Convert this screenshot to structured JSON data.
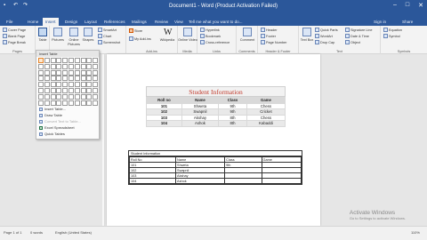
{
  "window": {
    "title": "Document1 - Word (Product Activation Failed)",
    "minimize": "–",
    "maximize": "□",
    "close": "✕"
  },
  "tabs": [
    "File",
    "Home",
    "Insert",
    "Design",
    "Layout",
    "References",
    "Mailings",
    "Review",
    "View"
  ],
  "active_tab": "Insert",
  "tell_me": "Tell me what you want to do...",
  "account": "Sign in",
  "share": "Share",
  "ribbon": {
    "pages": {
      "label": "Pages",
      "items": [
        "Cover Page",
        "Blank Page",
        "Page Break"
      ]
    },
    "tables": {
      "label": "Tables",
      "table_button": "Table"
    },
    "illustrations": {
      "label": "Illustrations",
      "pictures": "Pictures",
      "online_pictures": "Online Pictures",
      "shapes": "Shapes",
      "smartart": "SmartArt",
      "chart": "Chart",
      "screenshot": "Screenshot"
    },
    "addins": {
      "label": "Add-ins",
      "store": "Store",
      "my_addins": "My Add-ins",
      "wikipedia": "Wikipedia"
    },
    "media": {
      "label": "Media",
      "online_video": "Online Video"
    },
    "links": {
      "label": "Links",
      "hyperlink": "Hyperlink",
      "bookmark": "Bookmark",
      "cross_reference": "Cross-reference"
    },
    "comments": {
      "label": "Comments",
      "comment": "Comment"
    },
    "header_footer": {
      "label": "Header & Footer",
      "header": "Header",
      "footer": "Footer",
      "page_number": "Page Number"
    },
    "text": {
      "label": "Text",
      "text_box": "Text Box",
      "quick_parts": "Quick Parts",
      "wordart": "WordArt",
      "drop_cap": "Drop Cap",
      "signature_line": "Signature Line",
      "date_time": "Date & Time",
      "object": "Object"
    },
    "symbols": {
      "label": "Symbols",
      "equation": "Equation",
      "symbol": "Symbol"
    }
  },
  "table_dropdown": {
    "header": "Insert Table",
    "items": [
      "Insert Table...",
      "Draw Table",
      "Convert Text to Table...",
      "Excel Spreadsheet",
      "Quick Tables"
    ]
  },
  "table1": {
    "title": "Student Information",
    "headers": [
      "Roll no",
      "Name",
      "Class",
      "Game"
    ],
    "rows": [
      [
        "101",
        "Shweta",
        "9th",
        "Chess"
      ],
      [
        "102",
        "Swapnil",
        "9th",
        "Cricket"
      ],
      [
        "103",
        "Akshay",
        "8th",
        "Chess"
      ],
      [
        "104",
        "Ashok",
        "8th",
        "Kabaddi"
      ]
    ]
  },
  "table2": {
    "title": "Student Information",
    "headers": [
      "Roll No",
      "Name",
      "Class",
      "Game"
    ],
    "rows": [
      [
        "101",
        "Shweta",
        "9th",
        ""
      ],
      [
        "102",
        "Swapnil",
        "",
        ""
      ],
      [
        "103",
        "Akshay",
        "",
        ""
      ],
      [
        "104",
        "Ashok",
        "",
        ""
      ]
    ]
  },
  "status": {
    "page": "Page 1 of 1",
    "words": "0 words",
    "language": "English (United States)",
    "zoom": "110%"
  },
  "watermark": {
    "line1": "Activate Windows",
    "line2": "Go to Settings to activate Windows."
  }
}
